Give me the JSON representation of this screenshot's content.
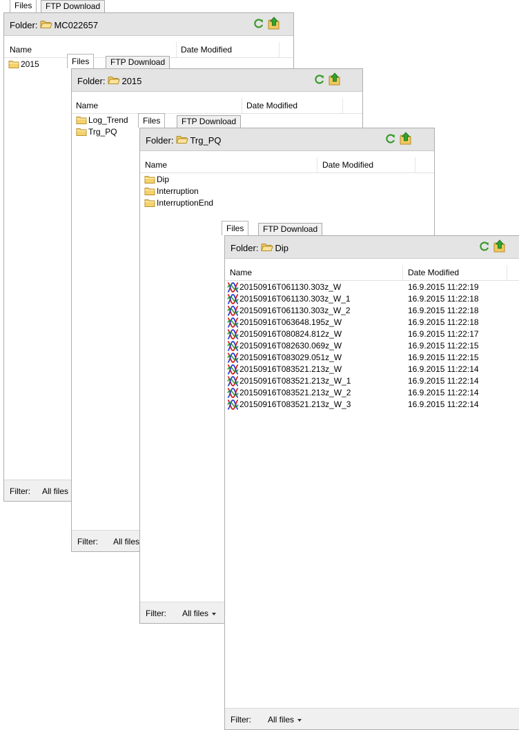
{
  "panels": [
    {
      "tabs": [
        "Files",
        "FTP Download"
      ],
      "folder_label": "Folder:",
      "folder_name": "MC022657",
      "columns": [
        "Name",
        "Date Modified"
      ],
      "rows": [
        {
          "name": "2015",
          "type": "folder",
          "date": ""
        }
      ],
      "filter_label": "Filter:",
      "filter_value": "All files"
    },
    {
      "tabs": [
        "Files",
        "FTP Download"
      ],
      "folder_label": "Folder:",
      "folder_name": "2015",
      "columns": [
        "Name",
        "Date Modified"
      ],
      "rows": [
        {
          "name": "Log_Trend",
          "type": "folder",
          "date": ""
        },
        {
          "name": "Trg_PQ",
          "type": "folder",
          "date": ""
        }
      ],
      "filter_label": "Filter:",
      "filter_value": "All files"
    },
    {
      "tabs": [
        "Files",
        "FTP Download"
      ],
      "folder_label": "Folder:",
      "folder_name": "Trg_PQ",
      "columns": [
        "Name",
        "Date Modified"
      ],
      "rows": [
        {
          "name": "Dip",
          "type": "folder",
          "date": ""
        },
        {
          "name": "Interruption",
          "type": "folder",
          "date": ""
        },
        {
          "name": "InterruptionEnd",
          "type": "folder",
          "date": ""
        }
      ],
      "filter_label": "Filter:",
      "filter_value": "All files"
    },
    {
      "tabs": [
        "Files",
        "FTP Download"
      ],
      "folder_label": "Folder:",
      "folder_name": "Dip",
      "columns": [
        "Name",
        "Date Modified"
      ],
      "rows": [
        {
          "name": "20150916T061130.303z_W",
          "type": "waveform",
          "date": "16.9.2015 11:22:19"
        },
        {
          "name": "20150916T061130.303z_W_1",
          "type": "waveform",
          "date": "16.9.2015 11:22:18"
        },
        {
          "name": "20150916T061130.303z_W_2",
          "type": "waveform",
          "date": "16.9.2015 11:22:18"
        },
        {
          "name": "20150916T063648.195z_W",
          "type": "waveform",
          "date": "16.9.2015 11:22:18"
        },
        {
          "name": "20150916T080824.812z_W",
          "type": "waveform",
          "date": "16.9.2015 11:22:17"
        },
        {
          "name": "20150916T082630.069z_W",
          "type": "waveform",
          "date": "16.9.2015 11:22:15"
        },
        {
          "name": "20150916T083029.051z_W",
          "type": "waveform",
          "date": "16.9.2015 11:22:15"
        },
        {
          "name": "20150916T083521.213z_W",
          "type": "waveform",
          "date": "16.9.2015 11:22:14"
        },
        {
          "name": "20150916T083521.213z_W_1",
          "type": "waveform",
          "date": "16.9.2015 11:22:14"
        },
        {
          "name": "20150916T083521.213z_W_2",
          "type": "waveform",
          "date": "16.9.2015 11:22:14"
        },
        {
          "name": "20150916T083521.213z_W_3",
          "type": "waveform",
          "date": "16.9.2015 11:22:14"
        }
      ],
      "filter_label": "Filter:",
      "filter_value": "All files"
    }
  ],
  "icons": {
    "folder": "folder-icon",
    "waveform": "waveform-file-icon",
    "refresh": "refresh-icon",
    "upload": "upload-icon",
    "filter_dropdown": "chevron-down-icon"
  },
  "colors": {
    "folder_yellow": "#f5d26b",
    "refresh_green": "#3a9a2a",
    "upload_green": "#2fa32c",
    "toolbar_gray": "#e4e4e4"
  }
}
